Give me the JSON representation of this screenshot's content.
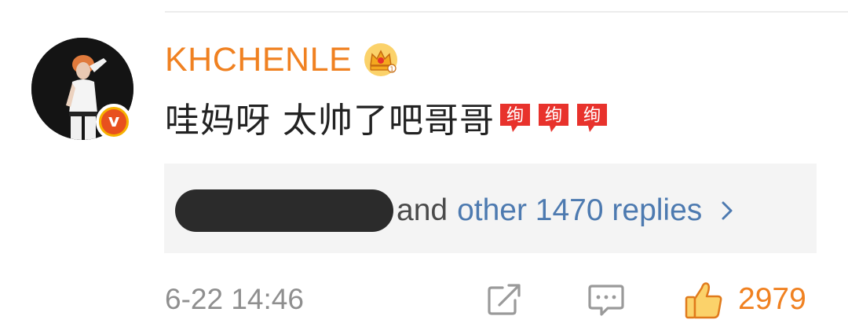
{
  "comment": {
    "username": "KHCHENLE",
    "text": "哇妈呀 太帅了吧哥哥",
    "emoji_stickers": [
      "绚",
      "绚",
      "绚"
    ],
    "badge_letter": "v"
  },
  "replies": {
    "and_text": "and",
    "link_text": "other 1470 replies"
  },
  "footer": {
    "timestamp": "6-22 14:46",
    "like_count": "2979"
  },
  "colors": {
    "username": "#f08121",
    "link": "#4d7ab0",
    "like": "#f08121",
    "badge_outer": "#f6b100",
    "badge_inner": "#e8501e",
    "sticker_red": "#e8322c"
  },
  "icons": {
    "crown": "crown-icon",
    "verified": "verified-v-icon",
    "chevron": "chevron-right-icon",
    "repost": "repost-icon",
    "comment": "comment-icon",
    "like": "thumbs-up-icon"
  }
}
